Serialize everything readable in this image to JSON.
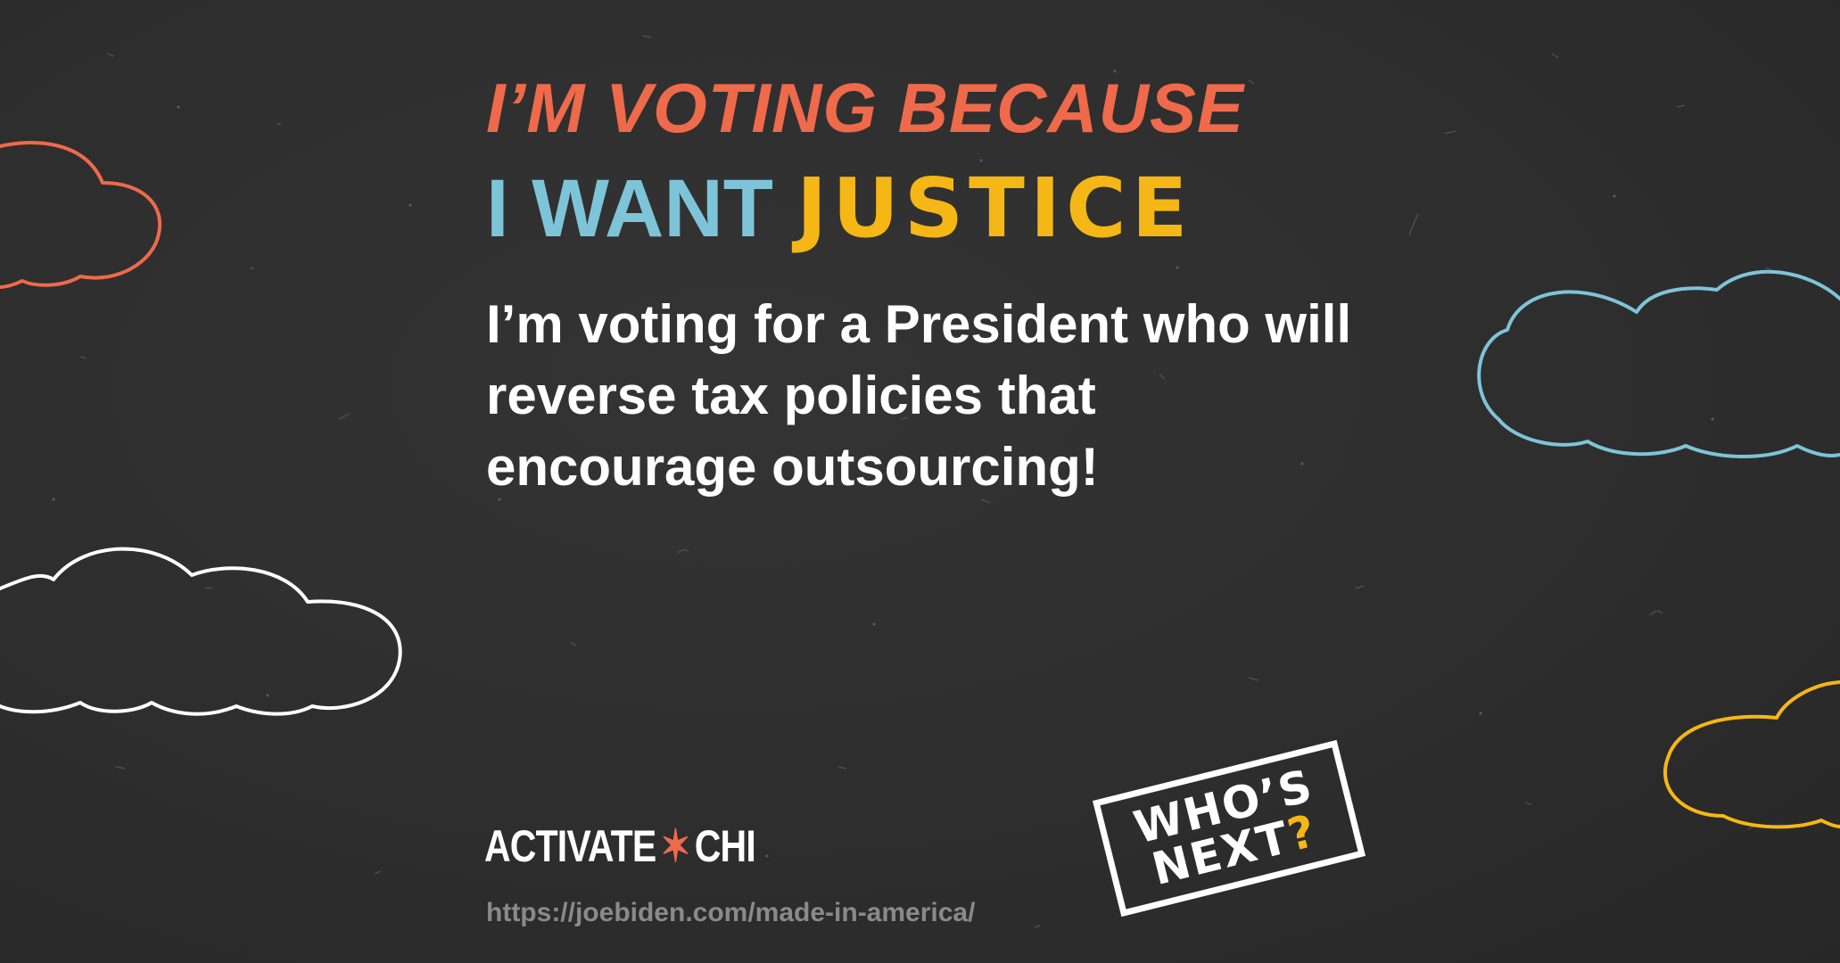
{
  "headline": {
    "line1": "I’M VOTING BECAUSE",
    "line2_a": "I WANT",
    "line2_b": "JUSTICE"
  },
  "body": {
    "lines": [
      "I’m voting for a President who will",
      "reverse tax policies that",
      "encourage outsourcing!"
    ]
  },
  "brand": {
    "left": "ACTIVATE",
    "star": "✶",
    "right": "CHI"
  },
  "source_url": "https://joebiden.com/made-in-america/",
  "stamp": {
    "line1": "WHO’S",
    "line2": "NEXT",
    "question": "?"
  },
  "colors": {
    "background": "#2e2e2e",
    "coral": "#ee6a4b",
    "light_blue": "#7ec4d8",
    "yellow": "#f5b715",
    "white": "#ffffff"
  },
  "icons": [
    "coral-cloud-icon",
    "white-cloud-icon",
    "blue-cloud-icon",
    "yellow-cloud-icon",
    "star-icon"
  ]
}
